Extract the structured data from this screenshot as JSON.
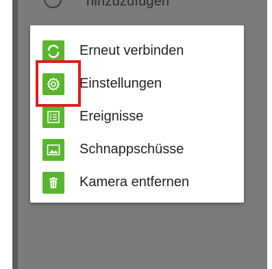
{
  "background": {
    "partial_text": "hinzuzufügen"
  },
  "menu": {
    "items": [
      {
        "label": "Erneut verbinden",
        "icon": "reconnect-icon"
      },
      {
        "label": "Einstellungen",
        "icon": "gear-icon"
      },
      {
        "label": "Ereignisse",
        "icon": "list-icon"
      },
      {
        "label": "Schnappschüsse",
        "icon": "image-icon"
      },
      {
        "label": "Kamera entfernen",
        "icon": "trash-icon"
      }
    ]
  },
  "colors": {
    "accent": "#5ab52e",
    "highlight": "#e01b1b",
    "overlay": "#7b7b7b"
  }
}
